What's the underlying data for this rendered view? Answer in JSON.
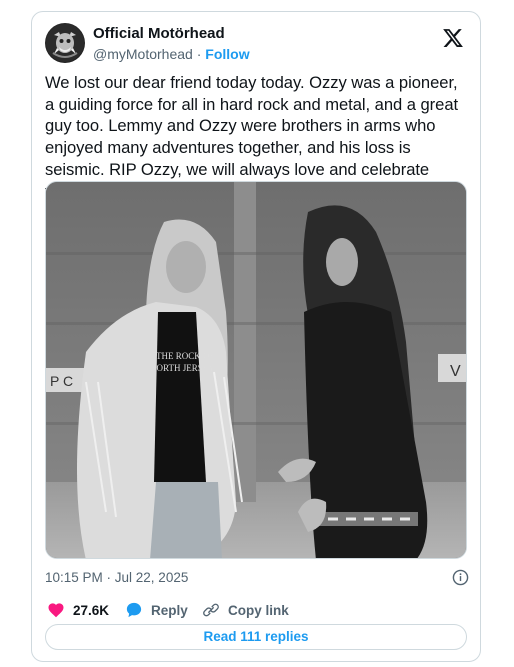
{
  "author": {
    "name": "Official Motörhead",
    "handle": "@myMotorhead",
    "separator": " · ",
    "follow_label": "Follow",
    "avatar_icon": "motorhead-warpig-avatar"
  },
  "platform_icon": "x-logo-icon",
  "tweet": {
    "text": "We lost our dear friend today today. Ozzy was a pioneer, a guiding force for all in hard rock and metal, and a great guy too. Lemmy and Ozzy were brothers in arms who enjoyed many adventures together, and his loss is seismic. RIP Ozzy, we will always love and celebrate you…"
  },
  "media": {
    "shirt_text_1": "THE ROCK OF",
    "shirt_text_2": "NORTH JERSEY",
    "sign_left": "P C",
    "sign_right": "V"
  },
  "meta": {
    "timestamp": "10:15 PM · Jul 22, 2025"
  },
  "actions": {
    "likes": "27.6K",
    "reply_label": "Reply",
    "copy_label": "Copy link"
  },
  "read_replies_label": "Read 111 replies",
  "colors": {
    "accent": "#1d9bf0",
    "like": "#f91880",
    "muted": "#536471",
    "border": "#cfd9de"
  }
}
